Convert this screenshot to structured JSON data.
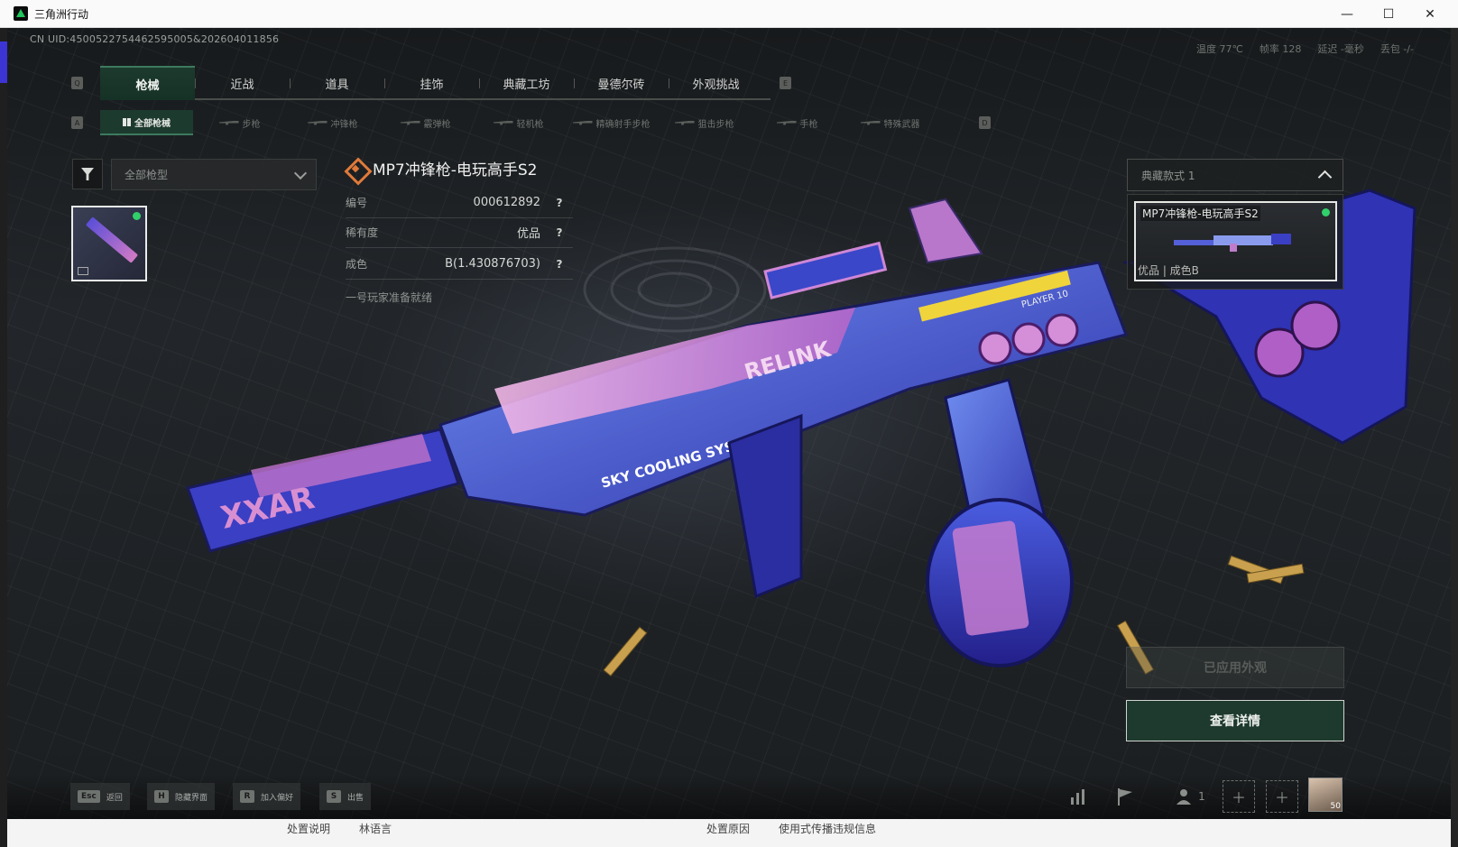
{
  "window": {
    "title": "三角洲行动",
    "minimize": "—",
    "maximize": "☐",
    "close": "✕"
  },
  "hud": {
    "uid": "CN UID:4500522754462595005&202604011856",
    "stats": [
      "温度 77℃",
      "帧率 128",
      "延迟 -毫秒",
      "丢包 -/-"
    ]
  },
  "keys": {
    "prev_tab": "Q",
    "next_tab": "E",
    "prev_sub": "A",
    "next_sub": "D"
  },
  "main_tabs": [
    "枪械",
    "近战",
    "道具",
    "挂饰",
    "典藏工坊",
    "曼德尔砖",
    "外观挑战"
  ],
  "sub_tabs": [
    "全部枪械",
    "步枪",
    "冲锋枪",
    "霰弹枪",
    "轻机枪",
    "精确射手步枪",
    "狙击步枪",
    "手枪",
    "特殊武器"
  ],
  "filter": {
    "placeholder": "全部枪型"
  },
  "item": {
    "name": "MP7冲锋枪-电玩高手S2",
    "rows": [
      {
        "label": "编号",
        "value": "000612892",
        "help": "?"
      },
      {
        "label": "稀有度",
        "value": "优品",
        "help": "?"
      },
      {
        "label": "成色",
        "value": "B(1.430876703)",
        "help": "?"
      }
    ],
    "description": "一号玩家准备就绪"
  },
  "variant": {
    "selector": "典藏款式 1",
    "card_title": "MP7冲锋枪-电玩高手S2",
    "card_sub": "优品 | 成色B"
  },
  "buttons": {
    "applied": "已应用外观",
    "detail": "查看详情"
  },
  "hotkeys": [
    {
      "key": "Esc",
      "label": "返回"
    },
    {
      "key": "H",
      "label": "隐藏界面"
    },
    {
      "key": "R",
      "label": "加入偏好"
    },
    {
      "key": "S",
      "label": "出售"
    }
  ],
  "bottom_right": {
    "team_count": "1",
    "avatar_level": "50"
  },
  "under_strip": [
    "处置说明",
    "林语言",
    "处置原因",
    "使用式传播违规信息"
  ],
  "colors": {
    "accent_green": "#1d3a2e",
    "status_dot": "#31d06a",
    "rarity_orange": "#e07a3a"
  },
  "art": {
    "barrel_text": "XXAR",
    "body_text": "RELINK",
    "cooling_text": "SKY COOLING SYSTEM",
    "tag_text": "PLAYER 10"
  }
}
